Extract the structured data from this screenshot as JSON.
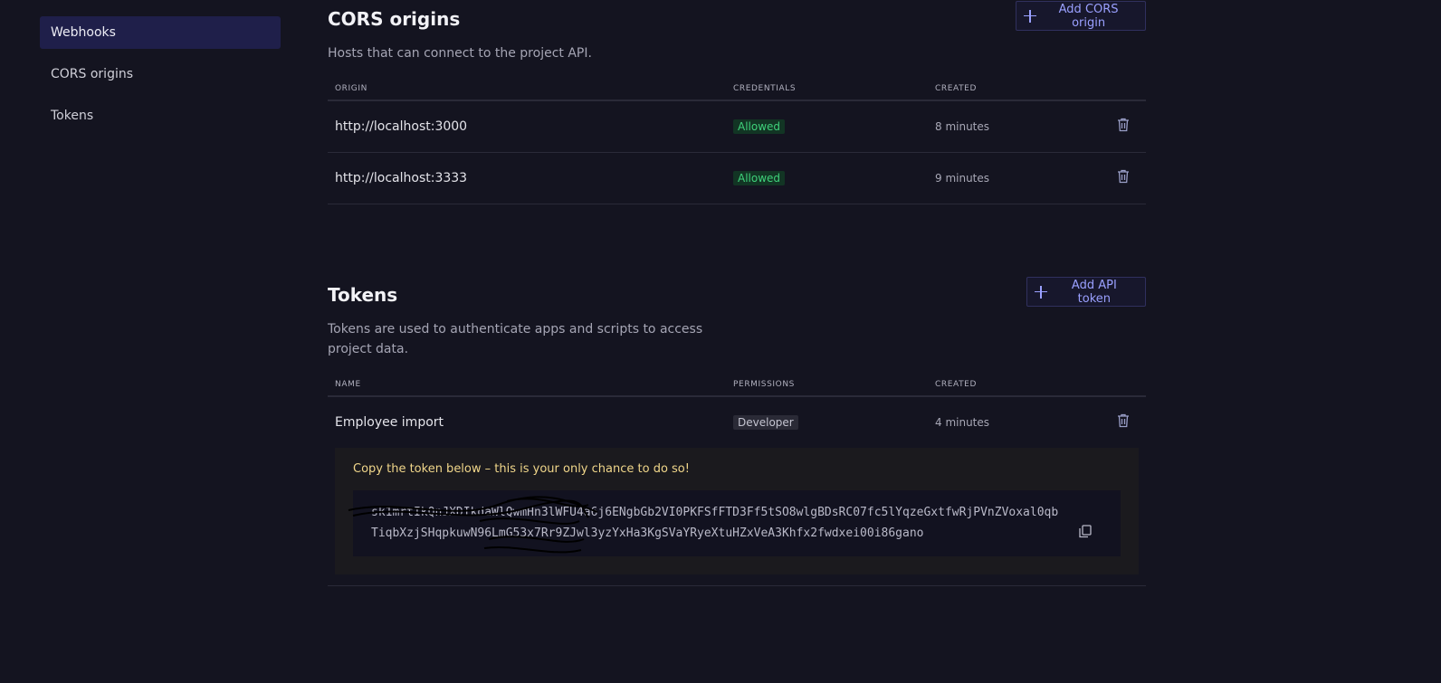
{
  "sidebar": {
    "items": [
      {
        "label": "Webhooks",
        "active": true
      },
      {
        "label": "CORS origins",
        "active": false
      },
      {
        "label": "Tokens",
        "active": false
      }
    ]
  },
  "cors": {
    "title": "CORS origins",
    "add_button": "Add CORS origin",
    "description": "Hosts that can connect to the project API.",
    "columns": [
      "ORIGIN",
      "CREDENTIALS",
      "CREATED"
    ],
    "rows": [
      {
        "origin": "http://localhost:3000",
        "credentials": "Allowed",
        "created": "8 minutes"
      },
      {
        "origin": "http://localhost:3333",
        "credentials": "Allowed",
        "created": "9 minutes"
      }
    ]
  },
  "tokens": {
    "title": "Tokens",
    "add_button": "Add API token",
    "description": "Tokens are used to authenticate apps and scripts to access project data.",
    "columns": [
      "NAME",
      "PERMISSIONS",
      "CREATED"
    ],
    "rows": [
      {
        "name": "Employee import",
        "permissions": "Developer",
        "created": "4 minutes"
      }
    ],
    "new_token": {
      "warning": "Copy the token below – this is your only chance to do so!",
      "value": "sk1mrtIkQnJXDIkdaWlQwmHn3lWFU4a6j6ENgbGb2VI0PKFSfFTD3Ff5tSO8wlgBDsRC07fc5lYqzeGxtfwRjPVnZVoxal0qbTiqbXzjSHqpkuwN96LmG53x7Rr9ZJwl3yzYxHa3KgSVaYRyeXtuHZxVeA3Khfx2fwdxei00i86gano"
    }
  },
  "colors": {
    "background": "#141420",
    "accent": "#9aa0ff",
    "allowed": "#3fd17a",
    "warning": "#f0d68a"
  },
  "icons": [
    "plus-icon",
    "trash-icon",
    "copy-icon"
  ]
}
